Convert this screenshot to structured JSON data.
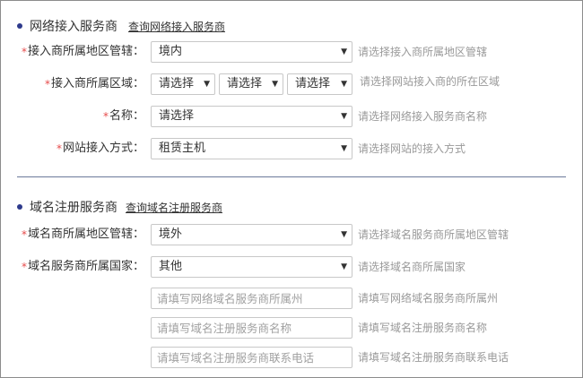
{
  "section_isp": {
    "title": "网络接入服务商",
    "link": "查询网络接入服务商",
    "rows": {
      "region_jurisdiction": {
        "label": "接入商所属地区管辖：",
        "value": "境内",
        "hint": "请选择接入商所属地区管辖"
      },
      "region_area": {
        "label": "接入商所属区域：",
        "province": "请选择",
        "city": "请选择",
        "district": "请选择",
        "hint": "请选择网站接入商的所在区域"
      },
      "name": {
        "label": "名称：",
        "value": "请选择",
        "hint": "请选择网络接入服务商名称"
      },
      "access_method": {
        "label": "网站接入方式：",
        "value": "租赁主机",
        "hint": "请选择网站的接入方式"
      }
    }
  },
  "section_registrar": {
    "title": "域名注册服务商",
    "link": "查询域名注册服务商",
    "rows": {
      "region_jurisdiction": {
        "label": "域名商所属地区管辖：",
        "value": "境外",
        "hint": "请选择域名服务商所属地区管辖"
      },
      "country": {
        "label": "域名服务商所属国家：",
        "value": "其他",
        "hint": "请选择域名商所属国家"
      },
      "state": {
        "placeholder": "请填写网络域名服务商所属州",
        "hint": "请填写网络域名服务商所属州"
      },
      "registrar_name": {
        "placeholder": "请填写域名注册服务商名称",
        "hint": "请填写域名注册服务商名称"
      },
      "registrar_phone": {
        "placeholder": "请填写域名注册服务商联系电话",
        "hint": "请填写域名注册服务商联系电话"
      }
    }
  },
  "icons": {
    "bullet": "bullet-dot",
    "required": "asterisk",
    "dropdown": "triangle-down"
  },
  "colors": {
    "bullet": "#2e3a8c",
    "required": "#e64a4a",
    "divider": "#6b7a9a",
    "hint_text": "#999999",
    "border": "#c8c8c8"
  }
}
